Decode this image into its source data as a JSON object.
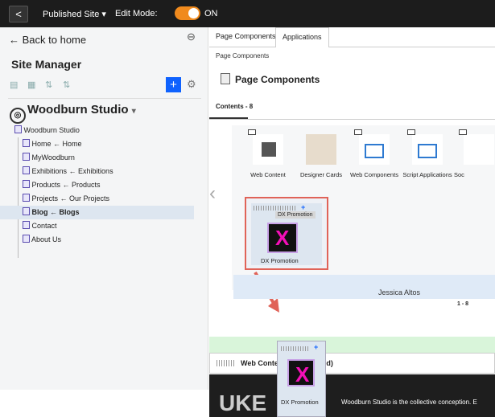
{
  "top": {
    "back": "<",
    "site_label": "Published Site",
    "edit_label": "Edit Mode:",
    "toggle_state": "ON"
  },
  "sidebar": {
    "back_home": "Back to home",
    "title": "Site Manager",
    "studio_name": "Woodburn Studio",
    "tree": [
      {
        "label": "Woodburn Studio"
      },
      {
        "label": "Home ← Home"
      },
      {
        "label": "MyWoodburn"
      },
      {
        "label": "Exhibitions ← Exhibitions"
      },
      {
        "label": "Products ← Products"
      },
      {
        "label": "Projects ← Our Projects"
      },
      {
        "label": "Blog ← Blogs"
      },
      {
        "label": "Contact"
      },
      {
        "label": "About Us"
      }
    ]
  },
  "main": {
    "tabs": [
      "Page Components",
      "Applications"
    ],
    "breadcrumb": "Page Components",
    "heading": "Page Components",
    "contents_label": "Contents - 8",
    "cards": [
      {
        "label": "Web Content"
      },
      {
        "label": "Designer Cards"
      },
      {
        "label": "Web Components"
      },
      {
        "label": "Script Applications"
      },
      {
        "label": "Soc"
      }
    ],
    "dx_label": "DX Promotion",
    "tooltip": "DX Promotion",
    "pager": "1 - 8",
    "name_text": "Jessica Altos",
    "web_content_label": "Web Content (Unspecified)",
    "footer_text": "Woodburn Studio is the collective conception. E",
    "dark_logo": "UKE"
  }
}
